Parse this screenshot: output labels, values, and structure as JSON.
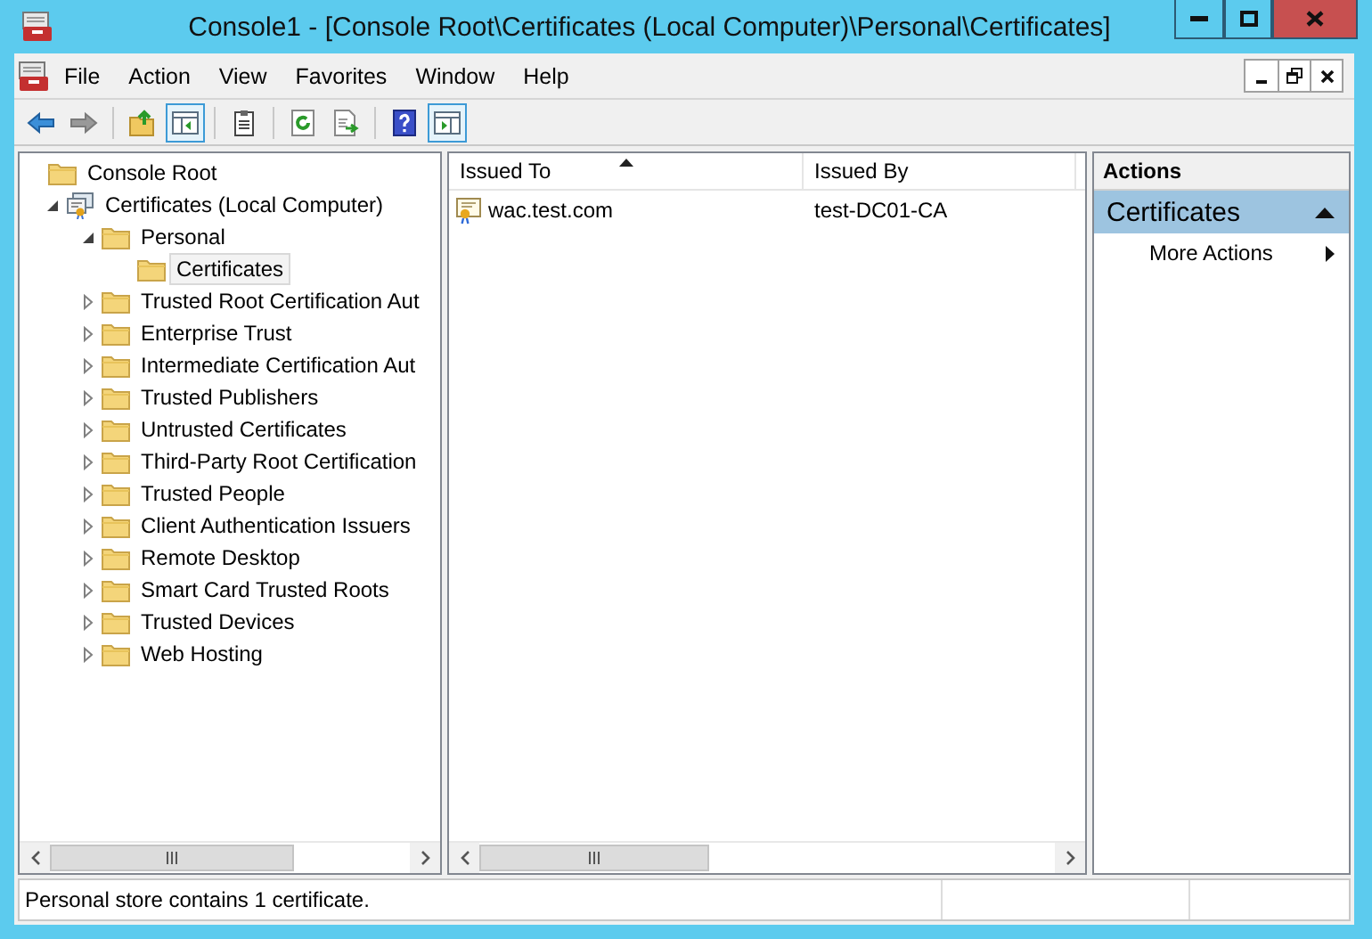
{
  "window": {
    "title": "Console1 - [Console Root\\Certificates (Local Computer)\\Personal\\Certificates]"
  },
  "menu": [
    "File",
    "Action",
    "View",
    "Favorites",
    "Window",
    "Help"
  ],
  "toolbar": [
    {
      "disabled": false,
      "pressed": false
    },
    {
      "disabled": true,
      "pressed": false
    },
    {
      "disabled": false,
      "pressed": false
    },
    {
      "disabled": false,
      "pressed": true
    },
    {
      "disabled": false,
      "pressed": false
    },
    {
      "disabled": false,
      "pressed": false
    },
    {
      "disabled": false,
      "pressed": false
    },
    {
      "disabled": false,
      "pressed": false
    },
    {
      "disabled": false,
      "pressed": true
    }
  ],
  "tree": [
    {
      "label": "Console Root",
      "kind": "folder",
      "selected": false,
      "children": [
        {
          "label": "Certificates (Local Computer)",
          "kind": "store",
          "selected": false,
          "expanded": true,
          "children": [
            {
              "label": "Personal",
              "kind": "folder",
              "selected": false,
              "expanded": true,
              "children": [
                {
                  "label": "Certificates",
                  "kind": "folder",
                  "selected": true
                }
              ]
            },
            {
              "label": "Trusted Root Certification Aut",
              "kind": "folder",
              "selected": false,
              "expanded": false
            },
            {
              "label": "Enterprise Trust",
              "kind": "folder",
              "selected": false,
              "expanded": false
            },
            {
              "label": "Intermediate Certification Aut",
              "kind": "folder",
              "selected": false,
              "expanded": false
            },
            {
              "label": "Trusted Publishers",
              "kind": "folder",
              "selected": false,
              "expanded": false
            },
            {
              "label": "Untrusted Certificates",
              "kind": "folder",
              "selected": false,
              "expanded": false
            },
            {
              "label": "Third-Party Root Certification",
              "kind": "folder",
              "selected": false,
              "expanded": false
            },
            {
              "label": "Trusted People",
              "kind": "folder",
              "selected": false,
              "expanded": false
            },
            {
              "label": "Client Authentication Issuers",
              "kind": "folder",
              "selected": false,
              "expanded": false
            },
            {
              "label": "Remote Desktop",
              "kind": "folder",
              "selected": false,
              "expanded": false
            },
            {
              "label": "Smart Card Trusted Roots",
              "kind": "folder",
              "selected": false,
              "expanded": false
            },
            {
              "label": "Trusted Devices",
              "kind": "folder",
              "selected": false,
              "expanded": false
            },
            {
              "label": "Web Hosting",
              "kind": "folder",
              "selected": false,
              "expanded": false
            }
          ]
        }
      ]
    }
  ],
  "table": {
    "columns": [
      {
        "label": "Issued To",
        "sorted": true
      },
      {
        "label": "Issued By",
        "sorted": false
      }
    ],
    "rows": [
      [
        "wac.test.com",
        "test-DC01-CA"
      ]
    ]
  },
  "actions": {
    "title": "Actions",
    "sections": [
      {
        "title": "Certificates",
        "expanded": true,
        "items": [
          "More Actions"
        ]
      }
    ]
  },
  "status_bar": "Personal store contains 1 certificate."
}
